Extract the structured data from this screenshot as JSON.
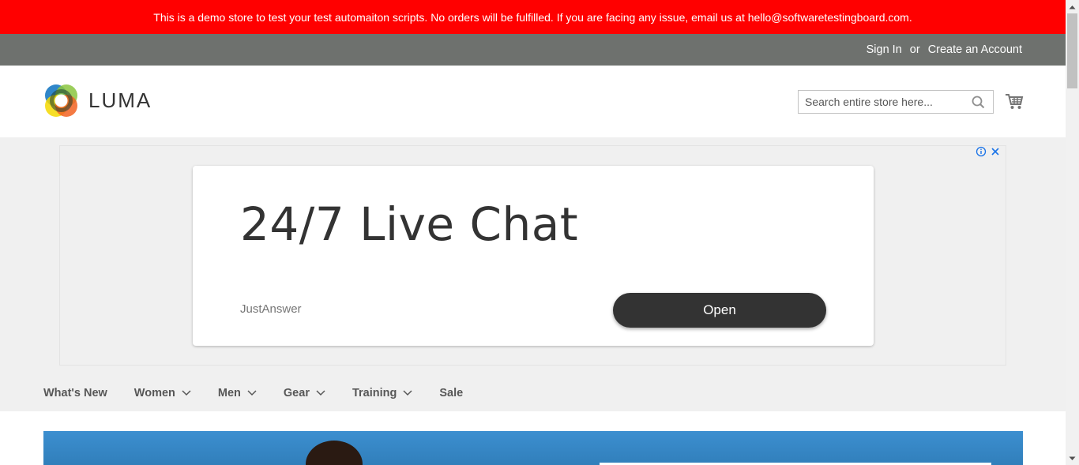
{
  "demo_banner": {
    "text": "This is a demo store to test your test automaiton scripts. No orders will be fulfilled. If you are facing any issue, email us at hello@softwaretestingboard.com."
  },
  "panel": {
    "sign_in": "Sign In",
    "or": "or",
    "create_account": "Create an Account"
  },
  "header": {
    "logo_text": "LUMA",
    "search_placeholder": "Search entire store here...",
    "icons": [
      "search-icon",
      "cart-icon"
    ]
  },
  "ad": {
    "headline": "24/7 Live Chat",
    "advertiser": "JustAnswer",
    "cta": "Open",
    "icons": [
      "adchoices-icon",
      "close-icon"
    ],
    "accent_color": "#1a73e8"
  },
  "nav": {
    "items": [
      {
        "label": "What's New",
        "has_dropdown": false
      },
      {
        "label": "Women",
        "has_dropdown": true
      },
      {
        "label": "Men",
        "has_dropdown": true
      },
      {
        "label": "Gear",
        "has_dropdown": true
      },
      {
        "label": "Training",
        "has_dropdown": true
      },
      {
        "label": "Sale",
        "has_dropdown": false
      }
    ]
  },
  "colors": {
    "banner": "#ff0000",
    "panel": "#6e716e",
    "nav_background": "#f0f0f0"
  }
}
